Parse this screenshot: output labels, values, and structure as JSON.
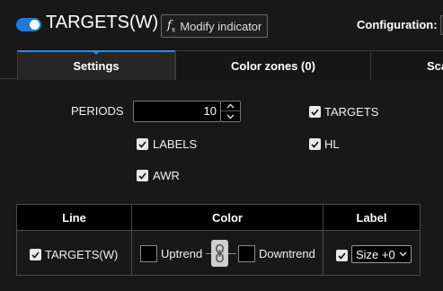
{
  "header": {
    "title": "TARGETS(W)",
    "modify_label": "Modify indicator",
    "fx_symbol": "f",
    "fx_subscript": "x",
    "config_label": "Configuration:",
    "enabled": true
  },
  "tabs": [
    {
      "label": "Settings",
      "active": true
    },
    {
      "label": "Color zones (0)",
      "active": false
    },
    {
      "label": "Sca",
      "active": false
    }
  ],
  "settings": {
    "periods_label": "PERIODS",
    "periods_value": "10",
    "targets_label": "TARGETS",
    "targets_checked": true,
    "labels_label": "LABELS",
    "labels_checked": true,
    "hl_label": "HL",
    "hl_checked": true,
    "awr_label": "AWR",
    "awr_checked": true
  },
  "table": {
    "headers": [
      "Line",
      "Color",
      "Label"
    ],
    "rows": [
      {
        "line_label": "TARGETS(W)",
        "line_checked": true,
        "uptrend_label": "Uptrend",
        "downtrend_label": "Downtrend",
        "label_checked": true,
        "label_select": "Size +0"
      }
    ]
  },
  "colors": {
    "accent": "#1f7ae0",
    "background": "#181818",
    "swatch_uptrend": "#000000",
    "swatch_downtrend": "#000000"
  }
}
